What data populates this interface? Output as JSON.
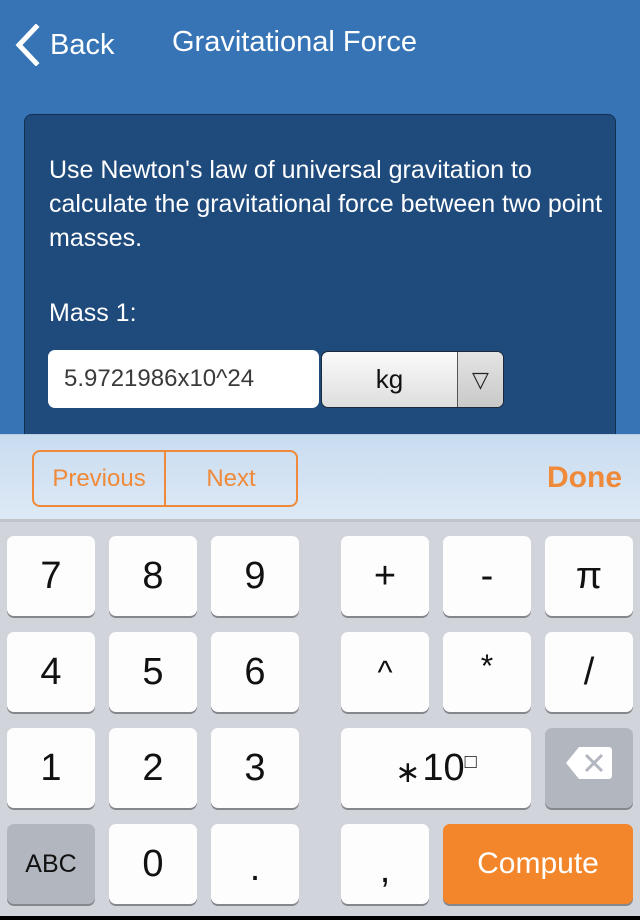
{
  "nav": {
    "back_label": "Back",
    "title": "Gravitational Force"
  },
  "panel": {
    "description": "Use Newton's law of universal gravitation to calculate the gravitational force between two point masses.",
    "mass1_label": "Mass 1:",
    "mass1_value": "5.9721986x10^24",
    "mass1_unit": "kg",
    "dropdown_glyph": "▽"
  },
  "toolbar": {
    "previous_label": "Previous",
    "next_label": "Next",
    "done_label": "Done"
  },
  "keyboard": {
    "keys": {
      "k7": "7",
      "k8": "8",
      "k9": "9",
      "k4": "4",
      "k5": "5",
      "k6": "6",
      "k1": "1",
      "k2": "2",
      "k3": "3",
      "k0": "0",
      "dot": ".",
      "comma": ",",
      "plus": "+",
      "minus": "-",
      "pi": "π",
      "caret": "^",
      "multiply": "*",
      "divide": "/",
      "abc": "ABC",
      "exp_star": "∗",
      "exp_base": "10",
      "exp_box": "□",
      "compute": "Compute"
    }
  },
  "colors": {
    "header_blue": "#3674b5",
    "panel_blue": "#1f4a7c",
    "accent_orange": "#f3862a",
    "keyboard_bg": "#d1d5db"
  }
}
